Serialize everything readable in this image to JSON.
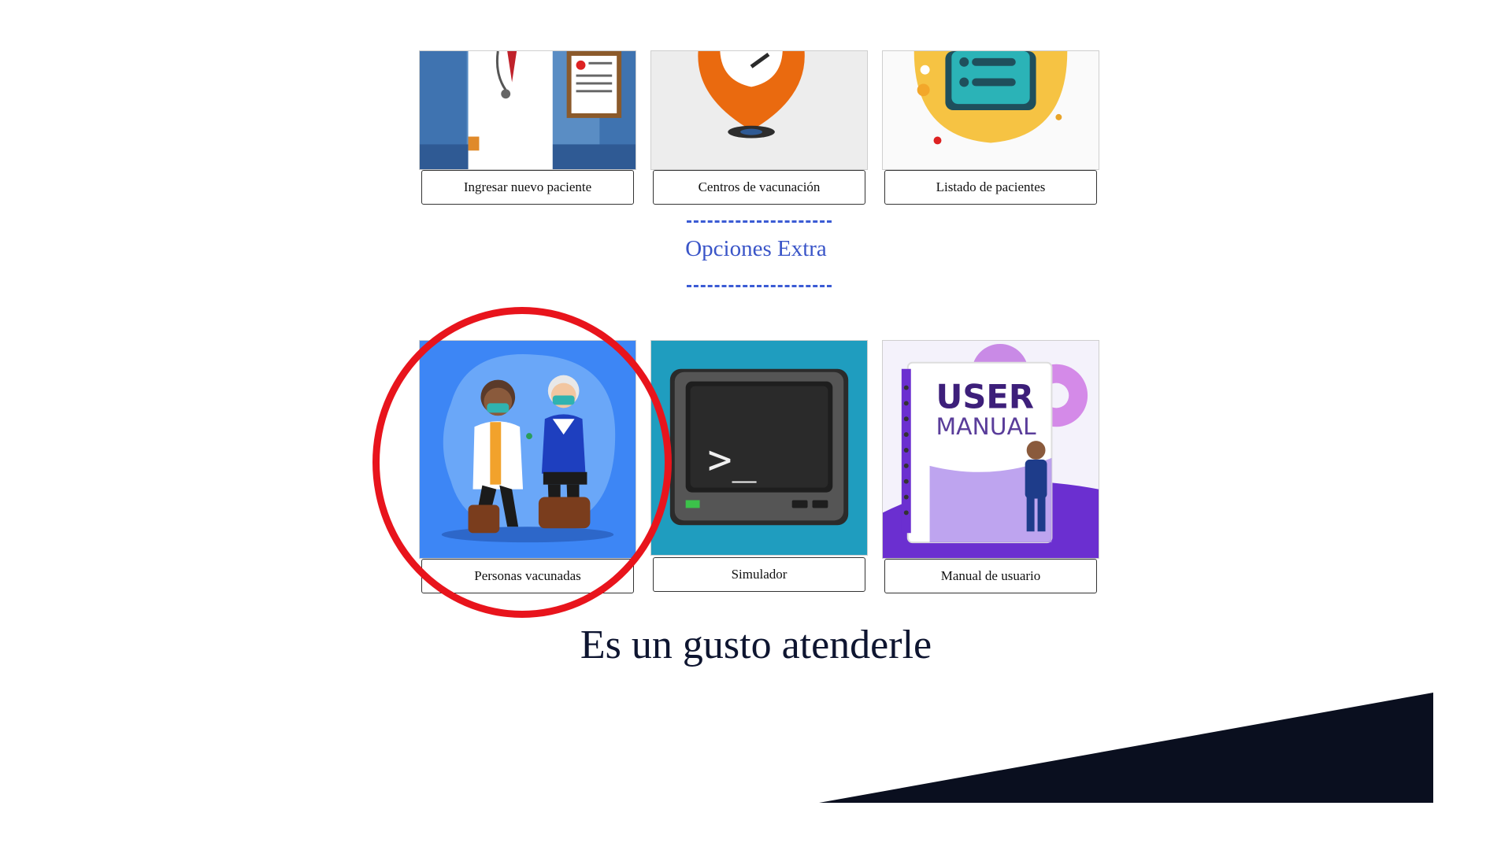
{
  "top_cards": [
    {
      "label": "Ingresar nuevo paciente",
      "icon": "doctor-illustration-icon"
    },
    {
      "label": "Centros de vacunación",
      "icon": "location-pin-icon"
    },
    {
      "label": "Listado de pacientes",
      "icon": "patient-list-icon"
    }
  ],
  "section": {
    "title": "Opciones Extra"
  },
  "extra_cards": [
    {
      "label": "Personas vacunadas",
      "icon": "vaccination-illustration-icon"
    },
    {
      "label": "Simulador",
      "icon": "terminal-monitor-icon"
    },
    {
      "label": "Manual de usuario",
      "icon": "user-manual-icon"
    }
  ],
  "manual_art": {
    "line1": "USER",
    "line2": "MANUAL"
  },
  "terminal_prompt": ">_",
  "footer": {
    "greeting": "Es un gusto atenderle"
  },
  "colors": {
    "accent_blue": "#3a55c8",
    "highlight_red": "#e8141c",
    "dark_navy": "#0a0f1f"
  }
}
